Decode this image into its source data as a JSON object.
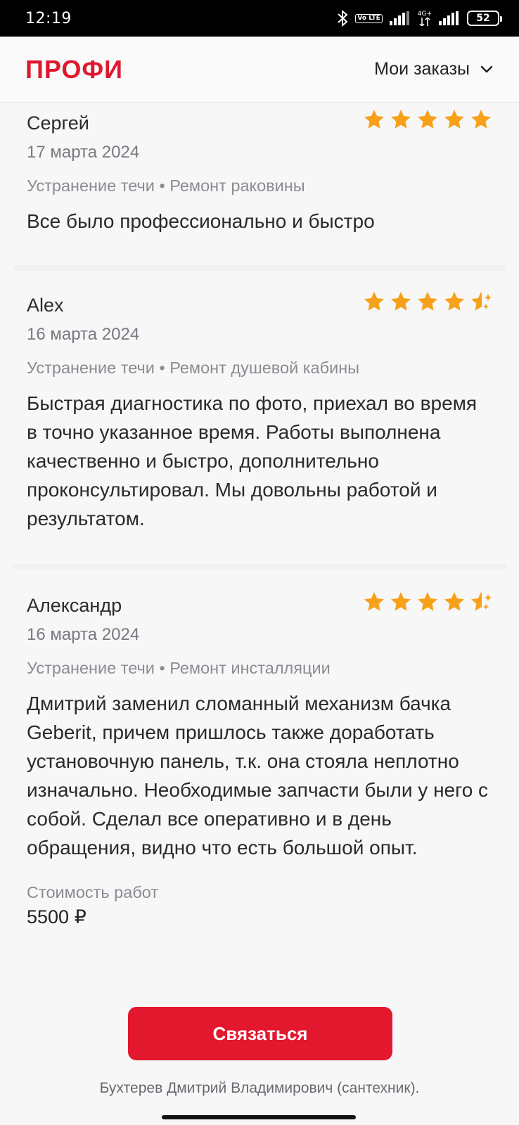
{
  "status_bar": {
    "time": "12:19",
    "battery": "52",
    "icons": [
      "bluetooth-icon",
      "volte-icon",
      "signal-icon",
      "4g-icon",
      "signal-icon",
      "battery-icon"
    ],
    "volte_label": "Vo LTE",
    "network_label": "4G+"
  },
  "header": {
    "logo": "ПРОФИ",
    "menu_label": "Мои заказы",
    "brand_color": "#e0182f"
  },
  "reviews": [
    {
      "author": "Сергей",
      "date": "17 марта 2024",
      "tags": "Устранение течи • Ремонт раковины",
      "text": "Все было профессионально и быстро",
      "rating": 5
    },
    {
      "author": "Alex",
      "date": "16 марта 2024",
      "tags": "Устранение течи • Ремонт душевой кабины",
      "text": "Быстрая диагностика по фото, приехал во время в точно указанное время. Работы выполнена качественно и быстро, дополнительно проконсультировал. Мы довольны работой и результатом.",
      "rating": 4.5
    },
    {
      "author": "Александр",
      "date": "16 марта 2024",
      "tags": "Устранение течи • Ремонт инсталляции",
      "text": "Дмитрий заменил сломанный механизм бачка Geberit, причем пришлось также доработать установочную панель, т.к. она стояла неплотно изначально. Необходимые запчасти были у него с собой. Сделал все оперативно и в день обращения, видно что есть большой опыт.",
      "rating": 4.5,
      "cost_label": "Стоимость работ",
      "cost_value": "5500 ₽"
    }
  ],
  "bottom": {
    "contact_label": "Связаться",
    "footer_name": "Бухтерев Дмитрий Владимирович (сантехник).",
    "button_color": "#e3172d"
  },
  "star_color": "#f7a11a"
}
